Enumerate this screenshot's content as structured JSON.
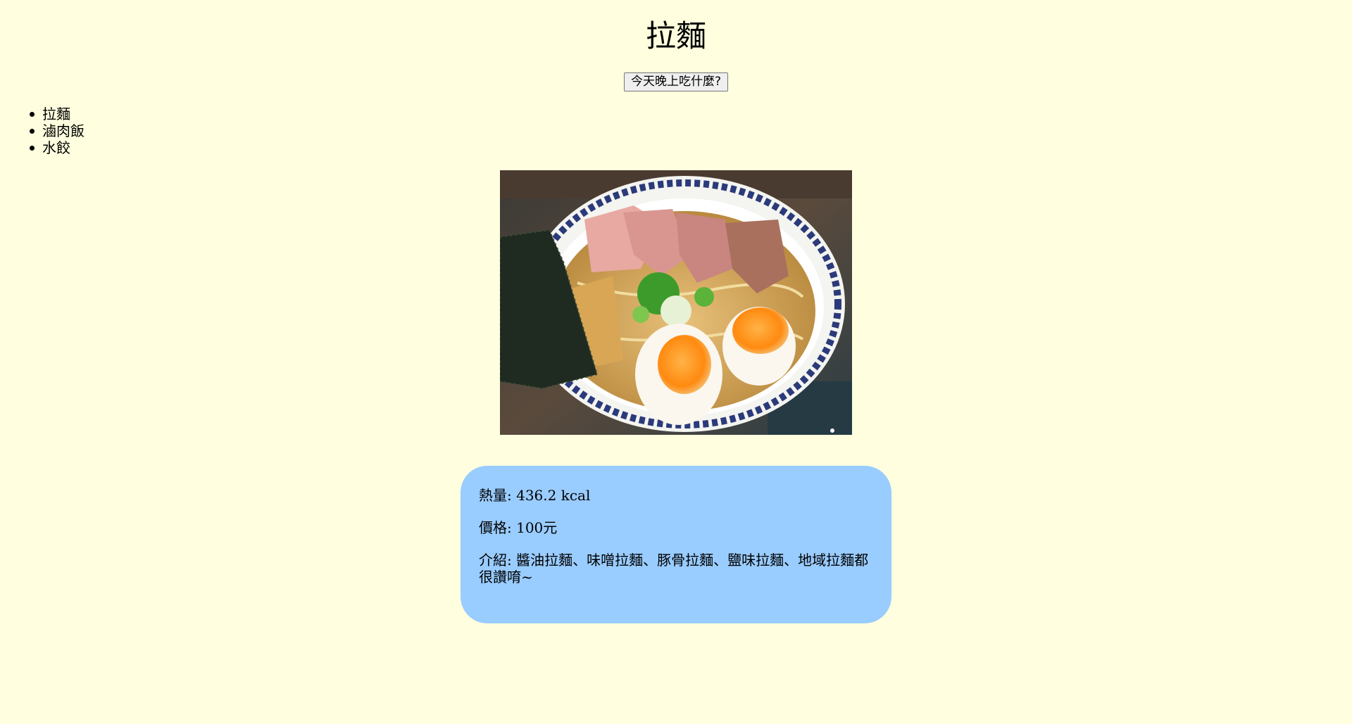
{
  "title": "拉麵",
  "button": {
    "label": "今天晚上吃什麼?"
  },
  "menu": {
    "items": [
      "拉麵",
      "滷肉飯",
      "水餃"
    ]
  },
  "photo": {
    "icon": "ramen-bowl-photo"
  },
  "info": {
    "calories": "熱量: 436.2 kcal",
    "price": "價格: 100元",
    "intro": "介紹: 醬油拉麵、味噌拉麵、豚骨拉麵、鹽味拉麵、地域拉麵都很讚唷~"
  },
  "colors": {
    "background": "#ffffdf",
    "card": "#99ccff"
  }
}
